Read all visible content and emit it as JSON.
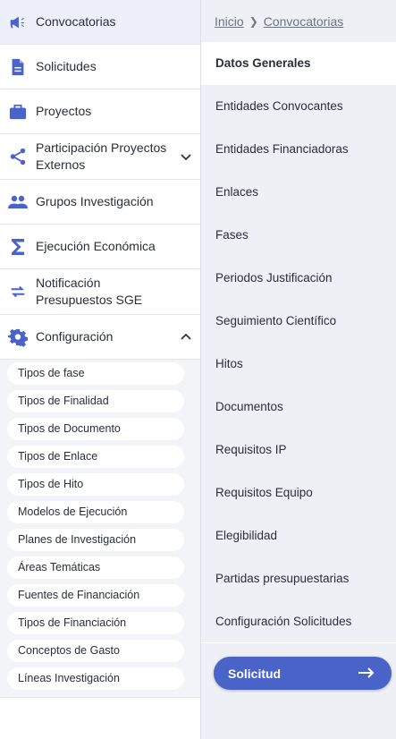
{
  "nav": {
    "items": [
      {
        "label": "Convocatorias",
        "icon": "megaphone-icon"
      },
      {
        "label": "Solicitudes",
        "icon": "document-icon"
      },
      {
        "label": "Proyectos",
        "icon": "briefcase-icon"
      },
      {
        "label": "Participación Proyectos Externos",
        "icon": "share-icon"
      },
      {
        "label": "Grupos Investigación",
        "icon": "group-icon"
      },
      {
        "label": "Ejecución Económica",
        "icon": "sigma-icon"
      },
      {
        "label": "Notificación Presupuestos SGE",
        "icon": "swap-arrows-icon"
      },
      {
        "label": "Configuración",
        "icon": "gear-icon"
      }
    ],
    "config_submenu": [
      "Tipos de fase",
      "Tipos de Finalidad",
      "Tipos de Documento",
      "Tipos de Enlace",
      "Tipos de Hito",
      "Modelos de Ejecución",
      "Planes de Investigación",
      "Áreas Temáticas",
      "Fuentes de Financiación",
      "Tipos de Financiación",
      "Conceptos de Gasto",
      "Líneas Investigación"
    ]
  },
  "breadcrumb": {
    "home": "Inicio",
    "current": "Convocatorias"
  },
  "sections": [
    "Datos Generales",
    "Entidades Convocantes",
    "Entidades Financiadoras",
    "Enlaces",
    "Fases",
    "Periodos Justificación",
    "Seguimiento Científico",
    "Hitos",
    "Documentos",
    "Requisitos IP",
    "Requisitos Equipo",
    "Elegibilidad",
    "Partidas presupuestarias",
    "Configuración Solicitudes"
  ],
  "active_section": "Datos Generales",
  "solicitud_button": {
    "label": "Solicitud",
    "icon": "arrow-right-icon"
  },
  "colors": {
    "accent": "#4a63c9",
    "icon": "#4a63c9",
    "active_bg": "#edf0fb",
    "panel_bg": "#eef0f5"
  }
}
